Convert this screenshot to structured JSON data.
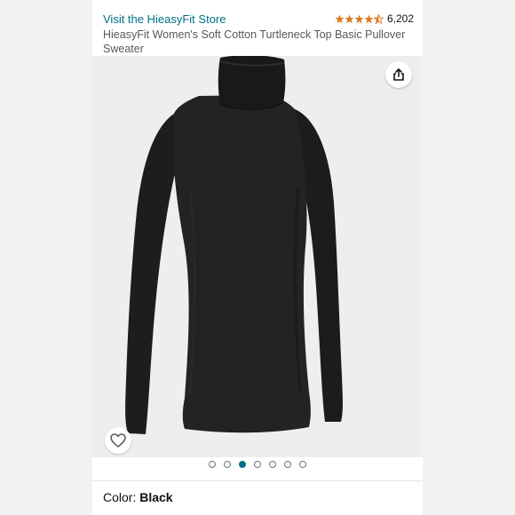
{
  "header": {
    "store_link": "Visit the HieasyFit Store",
    "rating": {
      "stars": 4.5,
      "review_count": "6,202"
    },
    "product_title": "HieasyFit Women's Soft Cotton Turtleneck Top Basic Pullover Sweater"
  },
  "gallery": {
    "image_count": 7,
    "active_index": 2,
    "share_icon": "share-icon",
    "favorite_icon": "heart-icon"
  },
  "variant": {
    "label": "Color: ",
    "value": "Black"
  },
  "colors": {
    "link": "#007185",
    "star": "#de7921",
    "product": "#1c1d1f"
  }
}
